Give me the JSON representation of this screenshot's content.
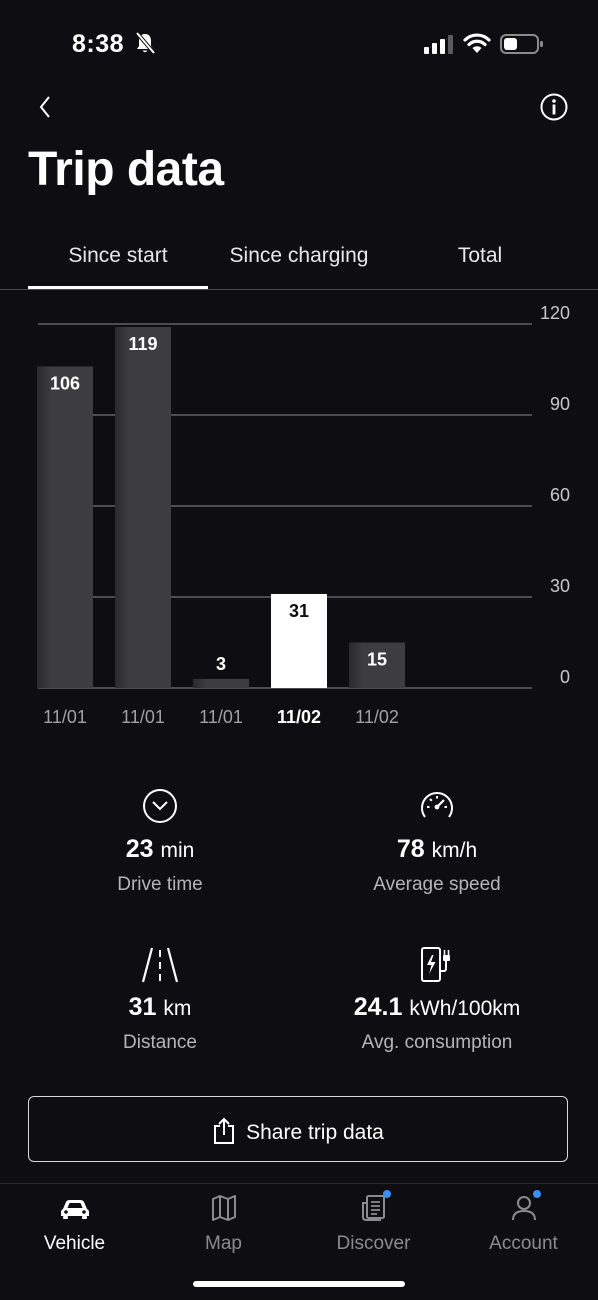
{
  "status_bar": {
    "time": "8:38"
  },
  "header": {
    "title": "Trip data"
  },
  "tabs": [
    {
      "label": "Since start",
      "selected": true
    },
    {
      "label": "Since charging",
      "selected": false
    },
    {
      "label": "Total",
      "selected": false
    }
  ],
  "chart_data": {
    "type": "bar",
    "categories": [
      "11/01",
      "11/01",
      "11/01",
      "11/02",
      "11/02"
    ],
    "values": [
      106,
      119,
      3,
      31,
      15
    ],
    "highlighted_index": 3,
    "y_ticks": [
      0,
      30,
      60,
      90,
      120
    ],
    "ylim": [
      0,
      120
    ],
    "y_axis_position": "right",
    "grid": true,
    "colors": {
      "bar": "#3c3c41",
      "highlight": "#ffffff",
      "grid": "#8a8a90"
    }
  },
  "stats": {
    "drive_time": {
      "value": "23",
      "unit": "min",
      "label": "Drive time"
    },
    "avg_speed": {
      "value": "78",
      "unit": "km/h",
      "label": "Average speed"
    },
    "distance": {
      "value": "31",
      "unit": "km",
      "label": "Distance"
    },
    "consumption": {
      "value": "24.1",
      "unit": "kWh/100km",
      "label": "Avg. consumption"
    }
  },
  "share_button": {
    "label": "Share trip data"
  },
  "bottom_nav": [
    {
      "label": "Vehicle",
      "icon": "car-icon",
      "active": true
    },
    {
      "label": "Map",
      "icon": "map-icon",
      "active": false
    },
    {
      "label": "Discover",
      "icon": "news-icon",
      "active": false,
      "badge": true
    },
    {
      "label": "Account",
      "icon": "person-icon",
      "active": false,
      "badge": true
    }
  ],
  "colors": {
    "background": "#0e0e12",
    "accent": "#3a8ef6"
  }
}
